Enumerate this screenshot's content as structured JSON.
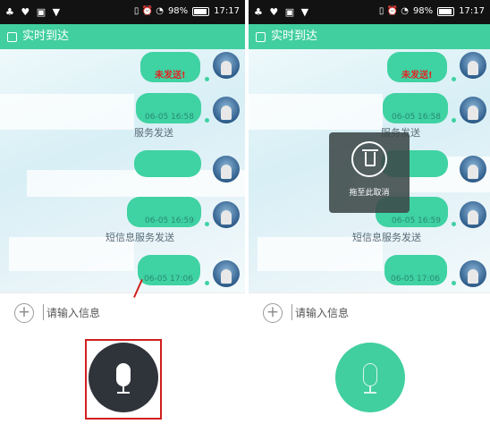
{
  "status": {
    "icons_left": "♣ ♥ ▣ ▼",
    "icons_right": "▯ ⏰ ◔",
    "battery": "98%",
    "time": "17:17"
  },
  "app": {
    "title": "实时到达"
  },
  "left": {
    "bubble1_fail": "未发送!",
    "bubble2_time": "06-05 16:58",
    "sys1": "服务发送",
    "bubble4_time": "06-05 16:59",
    "sys2": "短信息服务发送",
    "bubble5_time": "06-05 17:06",
    "input_placeholder": "请输入信息"
  },
  "right": {
    "bubble1_fail": "未发送!",
    "bubble2_time": "06-05 16:58",
    "sys1": "服务发送",
    "drag_cancel": "拖至此取消",
    "bubble4_time": "06-05 16:59",
    "sys2": "短信息服务发送",
    "bubble5_time": "06-05 17:06",
    "input_placeholder": "请输入信息"
  },
  "colors": {
    "accent": "#41cf9f",
    "mic_pressed": "#2f333a",
    "highlight": "#d21f1f"
  }
}
